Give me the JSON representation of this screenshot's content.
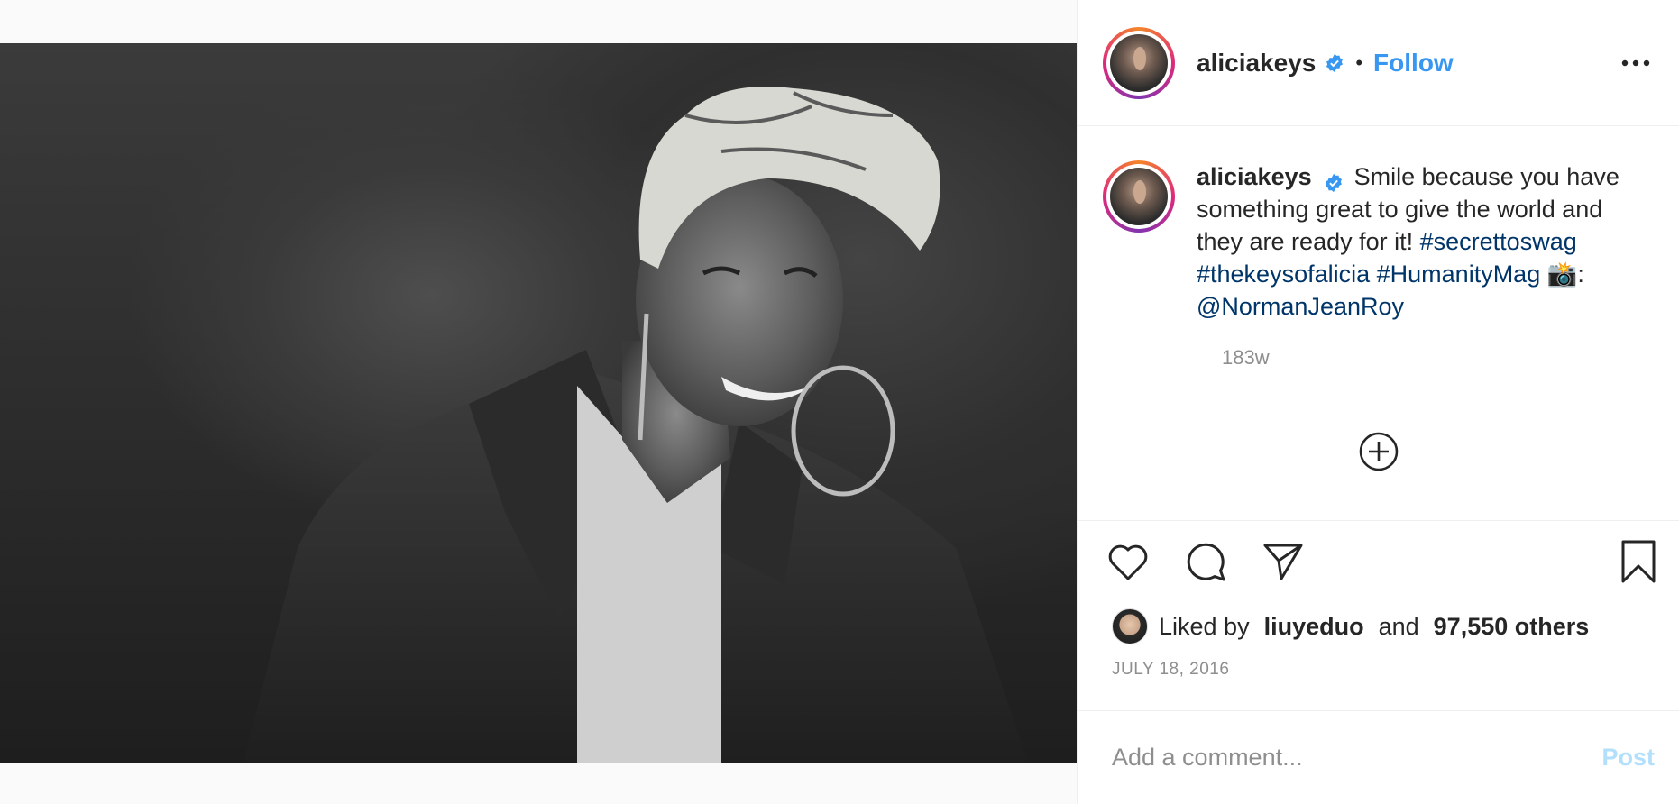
{
  "post": {
    "username": "aliciakeys",
    "verified": true,
    "follow_label": "Follow",
    "separator": "•",
    "more_icon": "more-options-icon",
    "photo_description_icon": "photo"
  },
  "caption": {
    "username": "aliciakeys",
    "text": "Smile because you have something great to give the world and they are ready for it!",
    "hashtags": [
      "#secrettoswag",
      "#thekeysofalicia",
      "#HumanityMag"
    ],
    "camera_emoji": "📸",
    "colon": ":",
    "mention": "@NormanJeanRoy",
    "time_ago": "183w"
  },
  "actions": {
    "like_icon": "heart-icon",
    "comment_icon": "comment-icon",
    "share_icon": "share-icon",
    "save_icon": "bookmark-icon",
    "load_more_icon": "plus-circle-icon"
  },
  "likes": {
    "prefix": "Liked by",
    "user": "liuyeduo",
    "and": "and",
    "others": "97,550 others"
  },
  "date": "JULY 18, 2016",
  "comment": {
    "placeholder": "Add a comment...",
    "post_label": "Post"
  },
  "colors": {
    "link_blue": "#3897f0",
    "hashtag_navy": "#003569",
    "muted": "#8e8e8e",
    "post_disabled": "#b2dffc"
  }
}
